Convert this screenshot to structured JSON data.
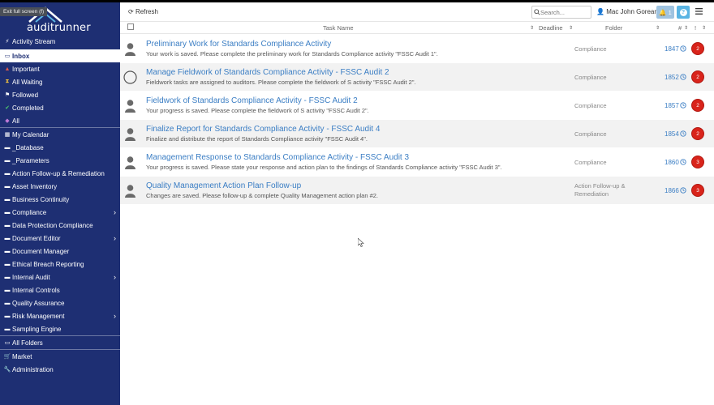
{
  "app": {
    "logo": "auditrunner",
    "fullscreen_tip": "Exit full screen (f)"
  },
  "sidebar": {
    "items": [
      {
        "label": "Activity Stream",
        "icon": "bolt-icon",
        "glyph": "⚡"
      },
      {
        "label": "Inbox",
        "icon": "inbox-icon",
        "glyph": "▭"
      },
      {
        "label": "Important",
        "icon": "warning-icon",
        "glyph": "▲"
      },
      {
        "label": "All Waiting",
        "icon": "hourglass-icon",
        "glyph": "⧗"
      },
      {
        "label": "Followed",
        "icon": "flag-icon",
        "glyph": "⚑"
      },
      {
        "label": "Completed",
        "icon": "check-icon",
        "glyph": "✔"
      },
      {
        "label": "All",
        "icon": "tag-icon",
        "glyph": "◆"
      },
      {
        "label": "My Calendar",
        "icon": "calendar-icon",
        "glyph": "▦"
      },
      {
        "label": "_Database",
        "icon": "folder-icon",
        "glyph": "▬"
      },
      {
        "label": "_Parameters",
        "icon": "folder-icon",
        "glyph": "▬"
      },
      {
        "label": "Action Follow-up & Remediation",
        "icon": "folder-icon",
        "glyph": "▬"
      },
      {
        "label": "Asset Inventory",
        "icon": "folder-icon",
        "glyph": "▬"
      },
      {
        "label": "Business Continuity",
        "icon": "folder-icon",
        "glyph": "▬"
      },
      {
        "label": "Compliance",
        "icon": "folder-icon",
        "glyph": "▬",
        "chevron": "›"
      },
      {
        "label": "Data Protection Compliance",
        "icon": "folder-icon",
        "glyph": "▬"
      },
      {
        "label": "Document Editor",
        "icon": "folder-icon",
        "glyph": "▬",
        "chevron": "›"
      },
      {
        "label": "Document Manager",
        "icon": "folder-icon",
        "glyph": "▬"
      },
      {
        "label": "Ethical Breach Reporting",
        "icon": "folder-icon",
        "glyph": "▬"
      },
      {
        "label": "Internal Audit",
        "icon": "folder-icon",
        "glyph": "▬",
        "chevron": "›"
      },
      {
        "label": "Internal Controls",
        "icon": "folder-icon",
        "glyph": "▬"
      },
      {
        "label": "Quality Assurance",
        "icon": "folder-icon",
        "glyph": "▬"
      },
      {
        "label": "Risk Management",
        "icon": "folder-icon",
        "glyph": "▬",
        "chevron": "›"
      },
      {
        "label": "Sampling Engine",
        "icon": "folder-icon",
        "glyph": "▬"
      },
      {
        "label": "All Folders",
        "icon": "folder-open-icon",
        "glyph": "▭"
      },
      {
        "label": "Market",
        "icon": "cart-icon",
        "glyph": "🛒"
      },
      {
        "label": "Administration",
        "icon": "wrench-icon",
        "glyph": "🔧"
      }
    ]
  },
  "toolbar": {
    "refresh_label": "Refresh",
    "search_placeholder": "Search...",
    "user_name": "Mac John Gorean",
    "notification_count": "1",
    "help_glyph": "?"
  },
  "table": {
    "columns": {
      "task": "Task Name",
      "deadline": "Deadline",
      "folder": "Folder",
      "num": "#",
      "priority": "!"
    },
    "rows": [
      {
        "title": "Preliminary Work for Standards Compliance Activity",
        "desc": "Your work is saved. Please complete the preliminary work for Standards Compliance activity \"FSSC Audit 1\".",
        "folder": "Compliance",
        "num": "1847",
        "badge": "2",
        "avatar": "person"
      },
      {
        "title": "Manage Fieldwork of Standards Compliance Activity - FSSC Audit 2",
        "desc": "Fieldwork tasks are assigned to auditors. Please complete the fieldwork of S activity \"FSSC Audit 2\".",
        "folder": "Compliance",
        "num": "1852",
        "badge": "2",
        "avatar": "circle"
      },
      {
        "title": "Fieldwork of Standards Compliance Activity - FSSC Audit 2",
        "desc": "Your progress is saved. Please complete the fieldwork of S activity \"FSSC Audit 2\".",
        "folder": "Compliance",
        "num": "1857",
        "badge": "2",
        "avatar": "person"
      },
      {
        "title": "Finalize Report for Standards Compliance Activity - FSSC Audit 4",
        "desc": "Finalize and distribute the report of Standards Compliance activity \"FSSC Audit 4\".",
        "folder": "Compliance",
        "num": "1854",
        "badge": "2",
        "avatar": "person"
      },
      {
        "title": "Management Response to Standards Compliance Activity - FSSC Audit 3",
        "desc": "Your progress is saved. Please state your response and action plan to the findings of Standards Compliance activity \"FSSC Audit 3\".",
        "folder": "Compliance",
        "num": "1860",
        "badge": "3",
        "avatar": "person"
      },
      {
        "title": "Quality Management Action Plan Follow-up",
        "desc": "Changes are saved. Please follow-up & complete Quality Management action plan #2.",
        "folder": "Action Follow-up & Remediation",
        "num": "1866",
        "badge": "3",
        "avatar": "person"
      }
    ]
  },
  "colors": {
    "sidebar": "#1e2f73",
    "link": "#3b7ec4",
    "badge": "#d9241b",
    "help": "#5ab4e3",
    "notif": "#9fc3e0"
  }
}
